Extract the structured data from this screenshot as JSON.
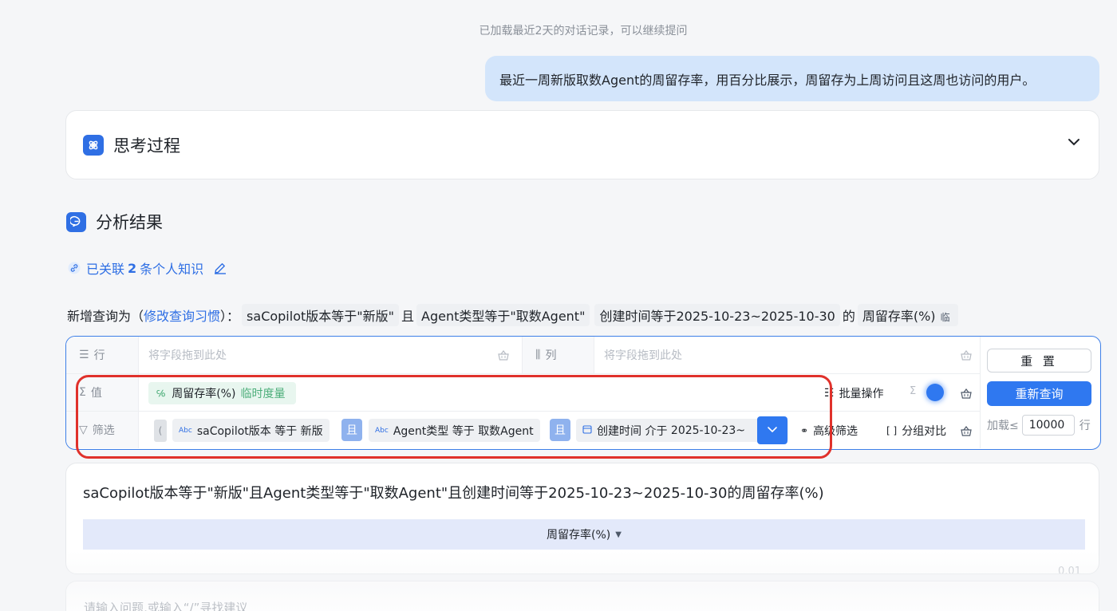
{
  "history_note": "已加载最近2天的对话记录，可以继续提问",
  "user_message": "最近一周新版取数Agent的周留存率，用百分比展示，周留存为上周访问且这周也访问的用户。",
  "thinking": {
    "title": "思考过程"
  },
  "analysis": {
    "title": "分析结果",
    "knowledge_prefix": "已关联",
    "knowledge_count": "2",
    "knowledge_suffix": "条个人知识"
  },
  "query_line": {
    "prefix": "新增查询为（",
    "modify_link": "修改查询习惯",
    "suffix": "）：",
    "chip1": "saCopilot版本等于\"新版\"",
    "and1": "且",
    "chip2": "Agent类型等于\"取数Agent\"",
    "chip3": "创建时间等于2025-10-23~2025-10-30",
    "of": "的",
    "chip4": "周留存率(%)",
    "tag": "临"
  },
  "builder": {
    "row_label": "行",
    "col_label": "列",
    "value_label": "值",
    "filter_label": "筛选",
    "row_placeholder": "将字段拖到此处",
    "col_placeholder": "将字段拖到此处",
    "measure": "周留存率(%)",
    "measure_sub": "临时度量",
    "batch_ops": "批量操作",
    "filters": [
      {
        "field": "saCopilot版本",
        "op": "等于",
        "value": "新版"
      },
      {
        "field": "Agent类型",
        "op": "等于",
        "value": "取数Agent"
      },
      {
        "field": "创建时间",
        "op": "介于",
        "value": "2025-10-23~"
      }
    ],
    "and_label": "且",
    "advanced_filter": "高级筛选",
    "group_compare": "分组对比",
    "reset": "重 置",
    "requery": "重新查询",
    "load_prefix": "加载≤",
    "load_value": "10000",
    "load_suffix": "行"
  },
  "result": {
    "title": "saCopilot版本等于\"新版\"且Agent类型等于\"取数Agent\"且创建时间等于2025-10-23~2025-10-30的周留存率(%)",
    "column": "周留存率(%)",
    "value": "0.01"
  },
  "input": {
    "placeholder": "请输入问题,或输入“/”寻找建议"
  },
  "colors": {
    "accent": "#2f78f0",
    "highlight": "#e0312b",
    "bubble": "#d3e5fb"
  }
}
